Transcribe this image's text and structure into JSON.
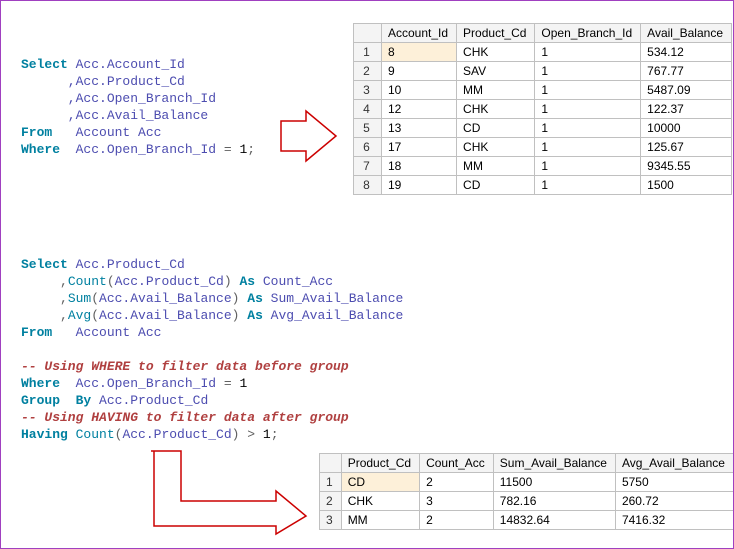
{
  "code1": {
    "l1a": "Select",
    "l1b": " Acc.Account_Id",
    "l2": "      ,Acc.Product_Cd",
    "l3": "      ,Acc.Open_Branch_Id",
    "l4": "      ,Acc.Avail_Balance",
    "l5a": "From",
    "l5b": "   Account Acc",
    "l6a": "Where",
    "l6b": "  Acc.Open_Branch_Id ",
    "l6c": "=",
    "l6d": " 1",
    "l6e": ";"
  },
  "table1": {
    "headers": [
      "Account_Id",
      "Product_Cd",
      "Open_Branch_Id",
      "Avail_Balance"
    ],
    "rownums": [
      "1",
      "2",
      "3",
      "4",
      "5",
      "6",
      "7",
      "8"
    ],
    "rows": [
      [
        "8",
        "CHK",
        "1",
        "534.12"
      ],
      [
        "9",
        "SAV",
        "1",
        "767.77"
      ],
      [
        "10",
        "MM",
        "1",
        "5487.09"
      ],
      [
        "12",
        "CHK",
        "1",
        "122.37"
      ],
      [
        "13",
        "CD",
        "1",
        "10000"
      ],
      [
        "17",
        "CHK",
        "1",
        "125.67"
      ],
      [
        "18",
        "MM",
        "1",
        "9345.55"
      ],
      [
        "19",
        "CD",
        "1",
        "1500"
      ]
    ]
  },
  "code2": {
    "l1a": "Select",
    "l1b": " Acc.Product_Cd",
    "l2a": "     ,",
    "l2b": "Count",
    "l2c": "(",
    "l2d": "Acc.Product_Cd",
    "l2e": ")",
    "l2f": " As",
    "l2g": " Count_Acc",
    "l3a": "     ,",
    "l3b": "Sum",
    "l3c": "(",
    "l3d": "Acc.Avail_Balance",
    "l3e": ")",
    "l3f": " As",
    "l3g": " Sum_Avail_Balance",
    "l4a": "     ,",
    "l4b": "Avg",
    "l4c": "(",
    "l4d": "Acc.Avail_Balance",
    "l4e": ")",
    "l4f": " As",
    "l4g": " Avg_Avail_Balance",
    "l5a": "From",
    "l5b": "   Account Acc",
    "l7": "-- Using WHERE to filter data before group",
    "l8a": "Where",
    "l8b": "  Acc.Open_Branch_Id ",
    "l8c": "=",
    "l8d": " 1",
    "l9a": "Group",
    "l9b": "  By",
    "l9c": " Acc.Product_Cd",
    "l10": "-- Using HAVING to filter data after group",
    "l11a": "Having",
    "l11b": " Count",
    "l11c": "(",
    "l11d": "Acc.Product_Cd",
    "l11e": ")",
    "l11f": " >",
    "l11g": " 1",
    "l11h": ";"
  },
  "table2": {
    "headers": [
      "Product_Cd",
      "Count_Acc",
      "Sum_Avail_Balance",
      "Avg_Avail_Balance"
    ],
    "rownums": [
      "1",
      "2",
      "3"
    ],
    "rows": [
      [
        "CD",
        "2",
        "11500",
        "5750"
      ],
      [
        "CHK",
        "3",
        "782.16",
        "260.72"
      ],
      [
        "MM",
        "2",
        "14832.64",
        "7416.32"
      ]
    ]
  }
}
